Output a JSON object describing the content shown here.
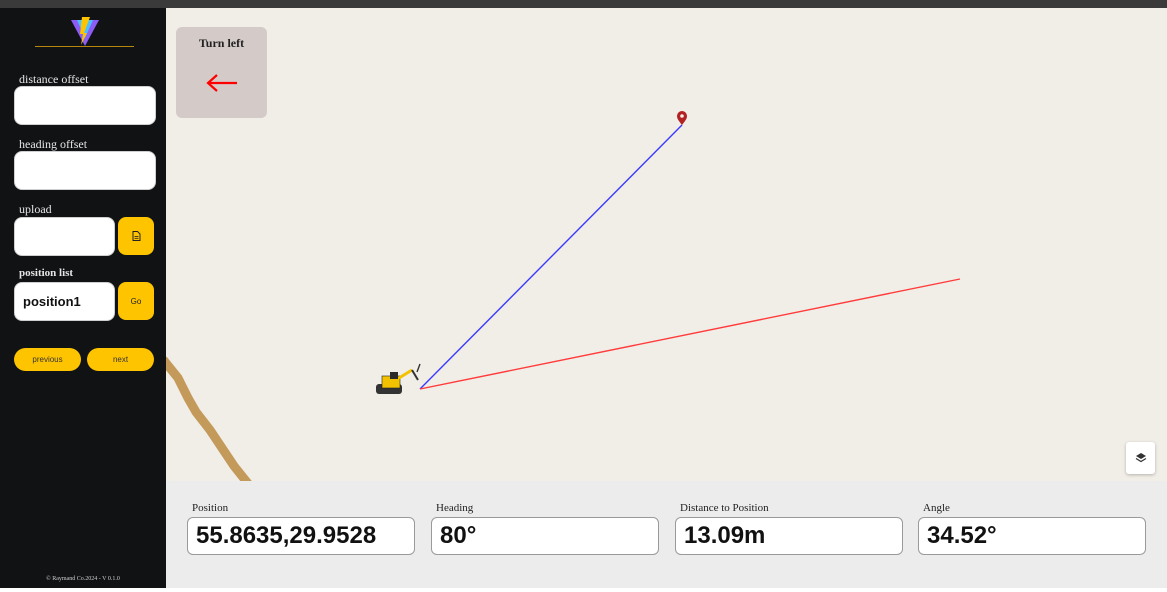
{
  "sidebar": {
    "logo_icon": "vite-logo-icon",
    "distance_offset_label": "distance offset",
    "distance_offset_value": "",
    "heading_offset_label": "heading offset",
    "heading_offset_value": "",
    "upload_label": "upload",
    "upload_value": "",
    "upload_button_icon": "file-icon",
    "position_list_label": "position list",
    "position_value": "position1",
    "go_label": "Go",
    "previous_label": "previous",
    "next_label": "next",
    "footer": "© Raymand Co.2024 - V 0.1.0"
  },
  "map": {
    "turn_title": "Turn left",
    "turn_icon": "arrow-left-icon",
    "target_icon": "map-pin-icon",
    "vehicle_icon": "excavator-icon",
    "layers_icon": "layers-icon",
    "heading_line_color": "#ff3b3b",
    "target_line_color": "#3a3aff"
  },
  "stats": {
    "position_label": "Position",
    "position_value": "55.8635,29.9528",
    "heading_label": "Heading",
    "heading_value": "80°",
    "distance_label": "Distance to Position",
    "distance_value": "13.09m",
    "angle_label": "Angle",
    "angle_value": "34.52°"
  },
  "colors": {
    "accent": "#ffc400",
    "sidebar_bg": "#111214",
    "map_bg": "#f1ede7",
    "turn_arrow": "#ff0000"
  }
}
